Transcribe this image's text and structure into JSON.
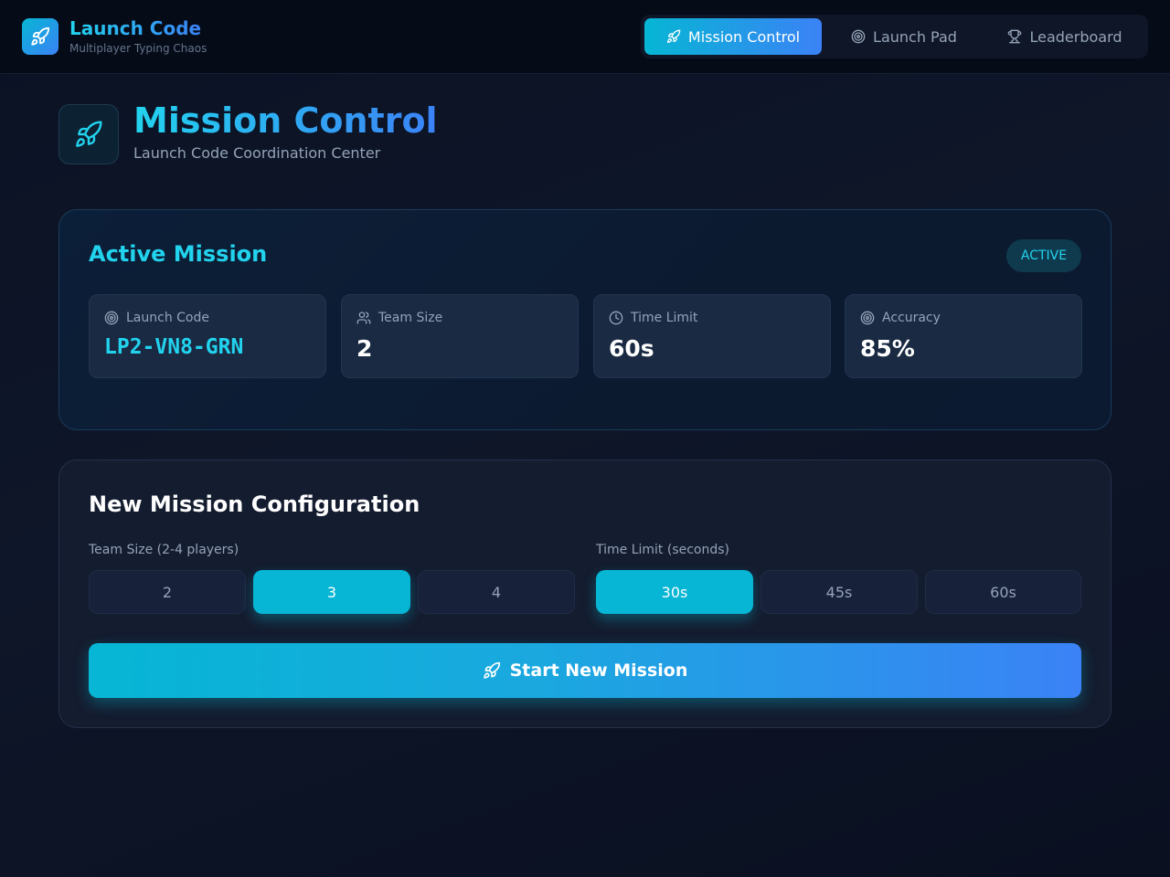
{
  "brand": {
    "title": "Launch Code",
    "subtitle": "Multiplayer Typing Chaos",
    "icon": "rocket-icon"
  },
  "nav": {
    "items": [
      {
        "label": "Mission Control",
        "icon": "rocket-icon",
        "active": true
      },
      {
        "label": "Launch Pad",
        "icon": "target-icon",
        "active": false
      },
      {
        "label": "Leaderboard",
        "icon": "trophy-icon",
        "active": false
      }
    ]
  },
  "header": {
    "title": "Mission Control",
    "subtitle": "Launch Code Coordination Center",
    "icon": "rocket-icon"
  },
  "active_mission": {
    "title": "Active Mission",
    "status": "ACTIVE",
    "stats": [
      {
        "label": "Launch Code",
        "value": "LP2-VN8-GRN",
        "icon": "target-icon"
      },
      {
        "label": "Team Size",
        "value": "2",
        "icon": "users-icon"
      },
      {
        "label": "Time Limit",
        "value": "60s",
        "icon": "clock-icon"
      },
      {
        "label": "Accuracy",
        "value": "85%",
        "icon": "target-icon"
      }
    ]
  },
  "config": {
    "title": "New Mission Configuration",
    "team_size": {
      "label": "Team Size (2-4 players)",
      "options": [
        "2",
        "3",
        "4"
      ],
      "selected": "3"
    },
    "time_limit": {
      "label": "Time Limit (seconds)",
      "options": [
        "30s",
        "45s",
        "60s"
      ],
      "selected": "30s"
    },
    "start_label": "Start New Mission"
  },
  "colors": {
    "accent_cyan": "#06b6d4",
    "accent_blue": "#3b82f6",
    "text_cyan": "#22d3ee",
    "background": "#0b1224"
  }
}
